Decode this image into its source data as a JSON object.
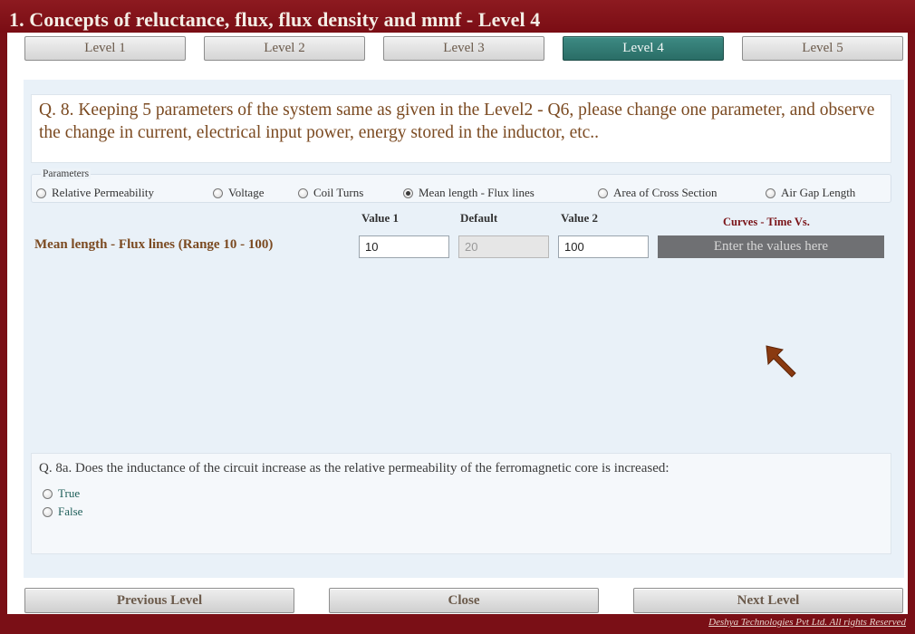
{
  "window": {
    "title": "1. Concepts of reluctance, flux, flux density and mmf - Level 4"
  },
  "tabs": [
    {
      "label": "Level 1",
      "active": false
    },
    {
      "label": "Level 2",
      "active": false
    },
    {
      "label": "Level 3",
      "active": false
    },
    {
      "label": "Level 4",
      "active": true
    },
    {
      "label": "Level 5",
      "active": false
    }
  ],
  "question": {
    "text": "Q. 8. Keeping 5 parameters of the system same as given in the Level2 - Q6, please change one parameter, and observe the change in current, electrical input power, energy stored in the inductor, etc.."
  },
  "parameters": {
    "legend": "Parameters",
    "options": [
      {
        "label": "Relative Permeability",
        "checked": false
      },
      {
        "label": "Voltage",
        "checked": false
      },
      {
        "label": "Coil Turns",
        "checked": false
      },
      {
        "label": "Mean length - Flux lines",
        "checked": true
      },
      {
        "label": "Area of Cross Section",
        "checked": false
      },
      {
        "label": "Air Gap Length",
        "checked": false
      }
    ]
  },
  "values": {
    "row_label": "Mean length - Flux lines (Range 10 - 100)",
    "value1_header": "Value 1",
    "default_header": "Default",
    "value2_header": "Value 2",
    "curves_header": "Curves - Time Vs.",
    "value1": "10",
    "default": "20",
    "value2": "100",
    "enter_button": "Enter the values here"
  },
  "q8a": {
    "text": "Q. 8a. Does the inductance of the circuit increase as the relative permeability of the ferromagnetic core is increased:",
    "options": [
      {
        "label": "True",
        "checked": false
      },
      {
        "label": "False",
        "checked": false
      }
    ]
  },
  "nav": {
    "previous": "Previous Level",
    "close": "Close",
    "next": "Next Level"
  },
  "footer": {
    "copyright": "Deshya Technologies Pvt Ltd. All rights Reserved"
  },
  "colors": {
    "brand": "#7a0f16",
    "active_tab": "#2f746d",
    "text_brown": "#7b4a21"
  }
}
